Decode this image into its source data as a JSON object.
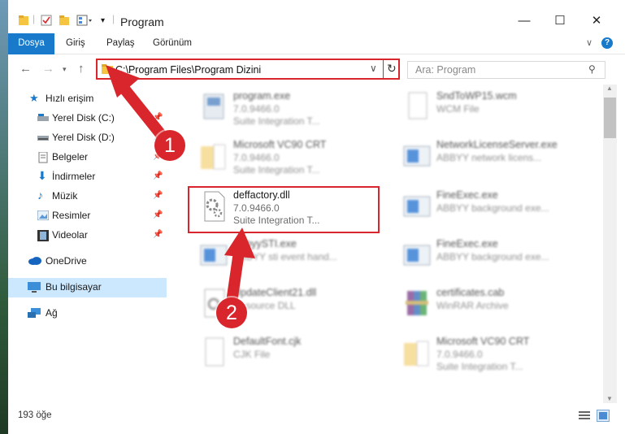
{
  "window": {
    "title": "Program"
  },
  "ribbon": {
    "tabs": [
      "Dosya",
      "Giriş",
      "Paylaş",
      "Görünüm"
    ]
  },
  "address": {
    "path": "C:\\Program Files\\Program Dizini"
  },
  "search": {
    "placeholder": "Ara: Program"
  },
  "sidebar": {
    "items": [
      {
        "label": "Hızlı erişim",
        "icon": "star-icon",
        "pinned": false
      },
      {
        "label": "Yerel Disk (C:)",
        "icon": "drive-icon",
        "pinned": true
      },
      {
        "label": "Yerel Disk (D:)",
        "icon": "drive-icon",
        "pinned": true
      },
      {
        "label": "Belgeler",
        "icon": "documents-icon",
        "pinned": true
      },
      {
        "label": "İndirmeler",
        "icon": "download-icon",
        "pinned": true
      },
      {
        "label": "Müzik",
        "icon": "music-icon",
        "pinned": true
      },
      {
        "label": "Resimler",
        "icon": "pictures-icon",
        "pinned": true
      },
      {
        "label": "Videolar",
        "icon": "video-icon",
        "pinned": true
      },
      {
        "label": "OneDrive",
        "icon": "cloud-icon",
        "pinned": false
      },
      {
        "label": "Bu bilgisayar",
        "icon": "computer-icon",
        "pinned": false,
        "selected": true
      },
      {
        "label": "Ağ",
        "icon": "network-icon",
        "pinned": false
      }
    ]
  },
  "files": [
    {
      "name": "program.exe",
      "line2": "7.0.9466.0",
      "line3": "Suite Integration T...",
      "icon": "exe-icon"
    },
    {
      "name": "SndToWP15.wcm",
      "line2": "WCM File",
      "line3": "",
      "icon": "document-icon"
    },
    {
      "name": "Microsoft VC90 CRT",
      "line2": "7.0.9466.0",
      "line3": "Suite Integration T...",
      "icon": "folder-icon"
    },
    {
      "name": "NetworkLicenseServer.exe",
      "line2": "ABBYY network licens...",
      "line3": "",
      "icon": "window-icon"
    },
    {
      "name": "deffactory.dll",
      "line2": "7.0.9466.0",
      "line3": "Suite Integration T...",
      "icon": "dll-icon"
    },
    {
      "name": "FineExec.exe",
      "line2": "ABBYY background exe...",
      "line3": "",
      "icon": "window-icon"
    },
    {
      "name": "AbbyySTI.exe",
      "line2": "ABBYY sti event hand...",
      "line3": "",
      "icon": "window-icon"
    },
    {
      "name": "FineExec.exe",
      "line2": "ABBYY background exe...",
      "line3": "",
      "icon": "window-icon"
    },
    {
      "name": "UpdateClient21.dll",
      "line2": "Resource DLL",
      "line3": "",
      "icon": "dll-icon"
    },
    {
      "name": "certificates.cab",
      "line2": "WinRAR Archive",
      "line3": "",
      "icon": "archive-icon"
    },
    {
      "name": "DefaultFont.cjk",
      "line2": "CJK File",
      "line3": "",
      "icon": "document-icon"
    },
    {
      "name": "Microsoft VC90 CRT",
      "line2": "7.0.9466.0",
      "line3": "Suite Integration T...",
      "icon": "folder-icon"
    }
  ],
  "annotations": [
    "1",
    "2"
  ],
  "status": {
    "count": "193 öğe"
  },
  "colors": {
    "accent": "#1979ca",
    "highlight": "#d9262c",
    "selected": "#cce8ff"
  }
}
